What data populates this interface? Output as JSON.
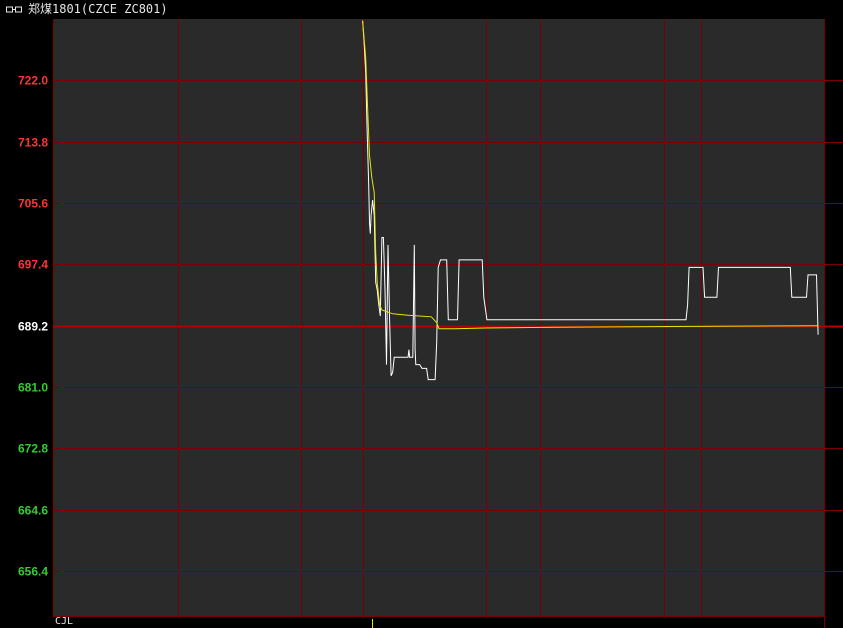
{
  "window": {
    "title": "郑煤1801(CZCE ZC801)",
    "link_icon": "link-icon"
  },
  "bottom_strip": {
    "label": "CJL"
  },
  "colors": {
    "background": "#000000",
    "plot_background": "#2a2a2a",
    "grid": "#7a0000",
    "prev_close_line": "#b00000",
    "price_line": "#ffffff",
    "avg_line": "#e6e600",
    "up_label": "#ff3333",
    "down_label": "#33cc33",
    "neutral_label": "#ffffff"
  },
  "chart_data": {
    "type": "line",
    "title": "",
    "xlabel": "",
    "ylabel": "",
    "ylim": [
      650.4,
      730.2
    ],
    "prev_close": 689.2,
    "grid": true,
    "y_ticks": [
      {
        "label": "722.0",
        "value": 722.0,
        "dir": "up"
      },
      {
        "label": "713.8",
        "value": 713.8,
        "dir": "up"
      },
      {
        "label": "705.6",
        "value": 705.6,
        "dir": "up"
      },
      {
        "label": "697.4",
        "value": 697.4,
        "dir": "up"
      },
      {
        "label": "689.2",
        "value": 689.2,
        "dir": "flat"
      },
      {
        "label": "681.0",
        "value": 681.0,
        "dir": "down"
      },
      {
        "label": "672.8",
        "value": 672.8,
        "dir": "down"
      },
      {
        "label": "664.6",
        "value": 664.6,
        "dir": "down"
      },
      {
        "label": "656.4",
        "value": 656.4,
        "dir": "down"
      }
    ],
    "x_range": [
      0,
      1
    ],
    "x_grid": [
      0.162,
      0.321,
      0.401,
      0.561,
      0.631,
      0.791,
      0.84
    ],
    "series": [
      {
        "key": "price",
        "values": [
          [
            0.401,
            730.0
          ],
          [
            0.403,
            727.0
          ],
          [
            0.405,
            723.0
          ],
          [
            0.407,
            715.0
          ],
          [
            0.409,
            708.0
          ],
          [
            0.41,
            703.0
          ],
          [
            0.411,
            701.5
          ],
          [
            0.412,
            704.0
          ],
          [
            0.414,
            706.0
          ],
          [
            0.416,
            704.0
          ],
          [
            0.418,
            695.0
          ],
          [
            0.42,
            694.0
          ],
          [
            0.422,
            692.0
          ],
          [
            0.424,
            690.5
          ],
          [
            0.426,
            701.0
          ],
          [
            0.428,
            701.0
          ],
          [
            0.43,
            694.0
          ],
          [
            0.432,
            684.0
          ],
          [
            0.434,
            700.0
          ],
          [
            0.436,
            690.0
          ],
          [
            0.438,
            682.5
          ],
          [
            0.44,
            683.0
          ],
          [
            0.442,
            685.0
          ],
          [
            0.446,
            685.0
          ],
          [
            0.45,
            685.0
          ],
          [
            0.458,
            685.0
          ],
          [
            0.46,
            685.0
          ],
          [
            0.461,
            686.0
          ],
          [
            0.462,
            685.0
          ],
          [
            0.466,
            685.0
          ],
          [
            0.468,
            700.0
          ],
          [
            0.469,
            686.0
          ],
          [
            0.47,
            684.0
          ],
          [
            0.475,
            684.0
          ],
          [
            0.478,
            683.5
          ],
          [
            0.484,
            683.5
          ],
          [
            0.486,
            682.0
          ],
          [
            0.493,
            682.0
          ],
          [
            0.495,
            682.0
          ],
          [
            0.497,
            687.0
          ],
          [
            0.499,
            697.0
          ],
          [
            0.502,
            698.0
          ],
          [
            0.51,
            698.0
          ],
          [
            0.512,
            690.0
          ],
          [
            0.524,
            690.0
          ],
          [
            0.526,
            698.0
          ],
          [
            0.556,
            698.0
          ],
          [
            0.558,
            693.0
          ],
          [
            0.562,
            690.0
          ],
          [
            0.82,
            690.0
          ],
          [
            0.822,
            692.0
          ],
          [
            0.824,
            697.0
          ],
          [
            0.842,
            697.0
          ],
          [
            0.844,
            693.0
          ],
          [
            0.86,
            693.0
          ],
          [
            0.862,
            697.0
          ],
          [
            0.955,
            697.0
          ],
          [
            0.957,
            693.0
          ],
          [
            0.976,
            693.0
          ],
          [
            0.978,
            696.0
          ],
          [
            0.989,
            696.0
          ],
          [
            0.991,
            688.0
          ]
        ]
      },
      {
        "key": "average",
        "values": [
          [
            0.401,
            730.0
          ],
          [
            0.405,
            725.0
          ],
          [
            0.408,
            717.0
          ],
          [
            0.41,
            712.0
          ],
          [
            0.413,
            709.0
          ],
          [
            0.416,
            707.0
          ],
          [
            0.418,
            699.0
          ],
          [
            0.42,
            695.0
          ],
          [
            0.423,
            692.0
          ],
          [
            0.426,
            691.3
          ],
          [
            0.44,
            690.8
          ],
          [
            0.46,
            690.6
          ],
          [
            0.49,
            690.4
          ],
          [
            0.497,
            689.6
          ],
          [
            0.5,
            688.8
          ],
          [
            0.52,
            688.8
          ],
          [
            0.56,
            688.9
          ],
          [
            0.65,
            689.0
          ],
          [
            0.8,
            689.1
          ],
          [
            0.991,
            689.2
          ]
        ]
      }
    ]
  }
}
